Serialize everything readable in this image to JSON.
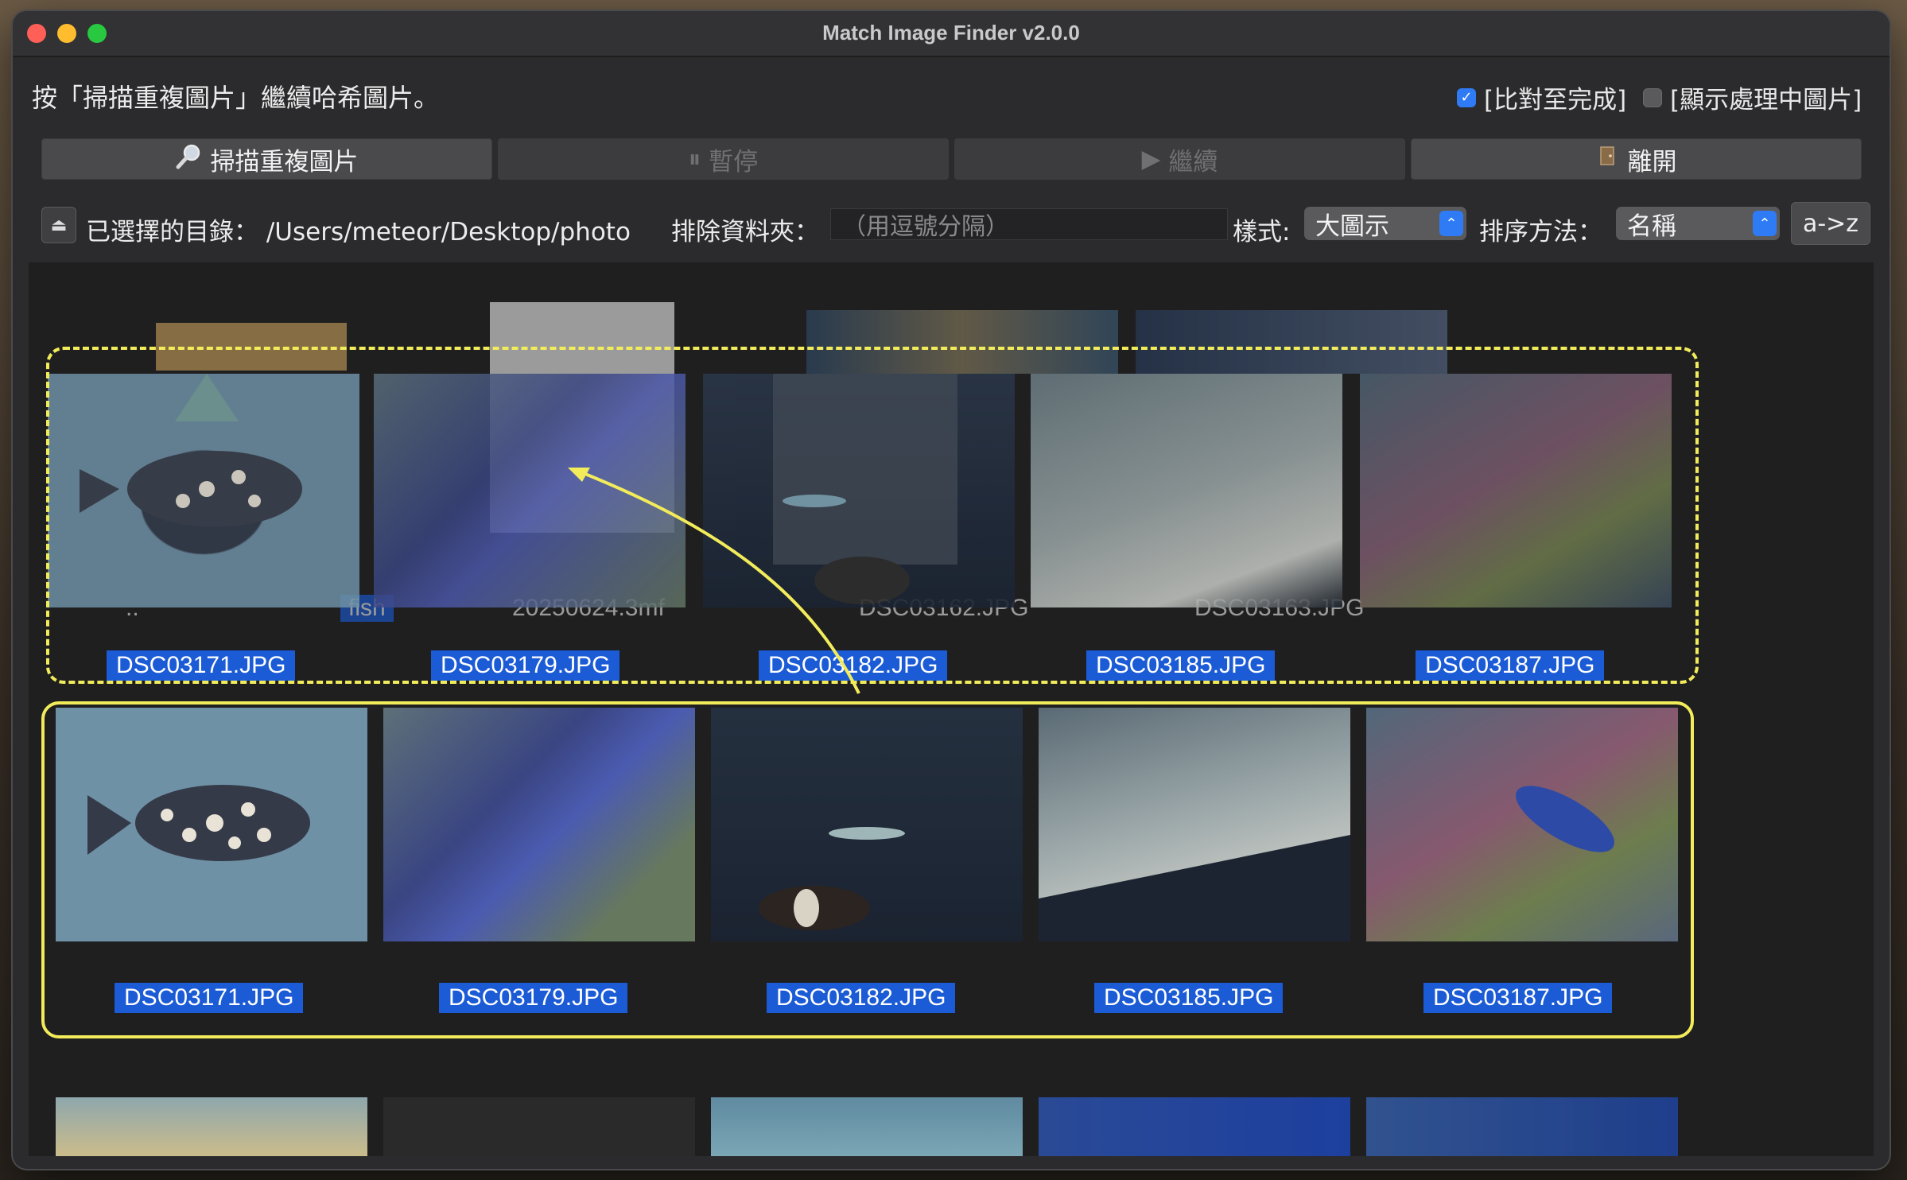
{
  "window": {
    "title": "Match Image Finder v2.0.0"
  },
  "status_text": "按「掃描重複圖片」繼續哈希圖片。",
  "options": [
    {
      "label": "[比對至完成]",
      "checked": true
    },
    {
      "label": "[顯示處理中圖片]",
      "checked": false
    }
  ],
  "toolbar": {
    "scan_label": "掃描重複圖片",
    "pause_label": "暫停",
    "resume_label": "繼續",
    "quit_label": "離開"
  },
  "directory": {
    "label": "已選擇的目錄：",
    "path": "/Users/meteor/Desktop/photo"
  },
  "exclude": {
    "label": "排除資料夾：",
    "placeholder": "（用逗號分隔）"
  },
  "style": {
    "label": "樣式:",
    "value": "大圖示"
  },
  "sort": {
    "label": "排序方法：",
    "value": "名稱",
    "order_button": "a->z"
  },
  "ghost_items": [
    "..",
    "fish",
    "20250624.3mf",
    "DSC03162.JPG",
    "DSC03163.JPG"
  ],
  "dragging_labels": [
    "DSC03171.JPG",
    "DSC03179.JPG",
    "DSC03182.JPG",
    "DSC03185.JPG",
    "DSC03187.JPG"
  ],
  "row_items": [
    "DSC03171.JPG",
    "DSC03179.JPG",
    "DSC03182.JPG",
    "DSC03185.JPG",
    "DSC03187.JPG"
  ],
  "colors": {
    "accent": "#1b5bd6",
    "highlight": "#f2ec5b",
    "window": "#2b2b2d"
  }
}
